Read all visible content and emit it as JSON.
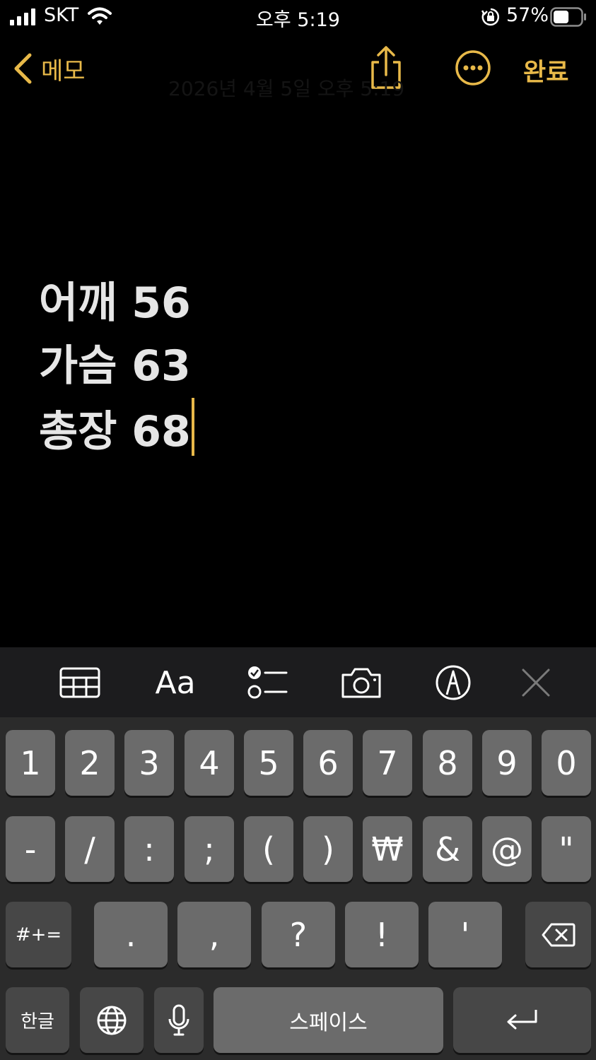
{
  "status": {
    "carrier": "SKT",
    "time": "오후 5:19",
    "battery": "57%",
    "battery_level": 0.57
  },
  "nav": {
    "back_label": "메모",
    "done_label": "완료"
  },
  "note": {
    "ghost_date": "2026년 4월 5일 오후 5:19",
    "lines": [
      "어깨 56",
      "가슴 63",
      "총장 68"
    ]
  },
  "toolbar": {
    "format_label": "Aa"
  },
  "keyboard": {
    "row1": [
      "1",
      "2",
      "3",
      "4",
      "5",
      "6",
      "7",
      "8",
      "9",
      "0"
    ],
    "row2": [
      "-",
      "/",
      ":",
      ";",
      "(",
      ")",
      "₩",
      "&",
      "@",
      "\""
    ],
    "row3_left": "#+=",
    "row3": [
      ".",
      ",",
      "?",
      "!",
      "'"
    ],
    "lang_key": "한글",
    "space": "스페이스"
  },
  "colors": {
    "accent": "#e8b949",
    "background": "#000000",
    "key": "#6b6b6b",
    "key_dark": "#474747"
  }
}
